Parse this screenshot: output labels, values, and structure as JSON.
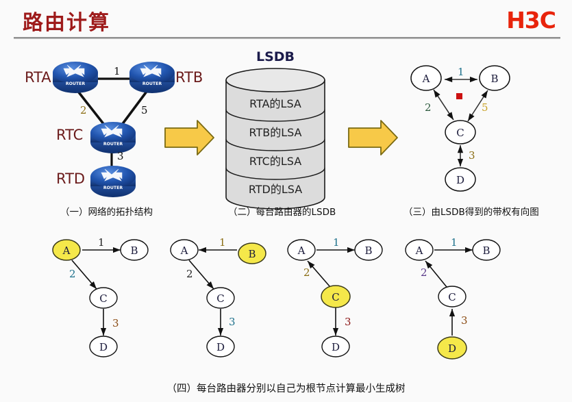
{
  "header": {
    "title": "路由计算",
    "logo": "H3C",
    "title_color": "#9e1b1b",
    "logo_color": "#e8240c"
  },
  "panel1": {
    "caption": "（一）网络的拓扑结构",
    "routers": [
      {
        "name": "RTA",
        "label": "ROUTER"
      },
      {
        "name": "RTB",
        "label": "ROUTER"
      },
      {
        "name": "RTC",
        "label": "ROUTER"
      },
      {
        "name": "RTD",
        "label": "ROUTER"
      }
    ],
    "links": [
      {
        "from": "RTA",
        "to": "RTB",
        "cost": "1"
      },
      {
        "from": "RTA",
        "to": "RTC",
        "cost": "2"
      },
      {
        "from": "RTB",
        "to": "RTC",
        "cost": "5"
      },
      {
        "from": "RTC",
        "to": "RTD",
        "cost": "3"
      }
    ]
  },
  "panel2": {
    "title": "LSDB",
    "caption": "（二）每台路由器的LSDB",
    "rows": [
      "RTA的LSA",
      "RTB的LSA",
      "RTC的LSA",
      "RTD的LSA"
    ]
  },
  "panel3": {
    "caption": "（三）由LSDB得到的带权有向图",
    "nodes": [
      "A",
      "B",
      "C",
      "D"
    ],
    "edges": [
      {
        "from": "A",
        "to": "B",
        "cost": "1",
        "bidirectional": true
      },
      {
        "from": "A",
        "to": "C",
        "cost": "2",
        "bidirectional": true
      },
      {
        "from": "B",
        "to": "C",
        "cost": "5",
        "bidirectional": true
      },
      {
        "from": "C",
        "to": "D",
        "cost": "3",
        "bidirectional": true
      }
    ],
    "marker": "red-square-marker"
  },
  "panel4": {
    "caption": "（四）每台路由器分别以自己为根节点计算最小生成树",
    "trees": [
      {
        "root": "A",
        "nodes": [
          "A",
          "B",
          "C",
          "D"
        ],
        "edges": [
          {
            "from": "A",
            "to": "B",
            "cost": "1"
          },
          {
            "from": "A",
            "to": "C",
            "cost": "2"
          },
          {
            "from": "C",
            "to": "D",
            "cost": "3"
          }
        ]
      },
      {
        "root": "B",
        "nodes": [
          "A",
          "B",
          "C",
          "D"
        ],
        "edges": [
          {
            "from": "B",
            "to": "A",
            "cost": "1"
          },
          {
            "from": "A",
            "to": "C",
            "cost": "2"
          },
          {
            "from": "C",
            "to": "D",
            "cost": "3"
          }
        ]
      },
      {
        "root": "C",
        "nodes": [
          "A",
          "B",
          "C",
          "D"
        ],
        "edges": [
          {
            "from": "A",
            "to": "B",
            "cost": "1"
          },
          {
            "from": "C",
            "to": "A",
            "cost": "2"
          },
          {
            "from": "C",
            "to": "D",
            "cost": "3"
          }
        ]
      },
      {
        "root": "D",
        "nodes": [
          "A",
          "B",
          "C",
          "D"
        ],
        "edges": [
          {
            "from": "A",
            "to": "B",
            "cost": "1"
          },
          {
            "from": "C",
            "to": "A",
            "cost": "2"
          },
          {
            "from": "D",
            "to": "C",
            "cost": "3"
          }
        ]
      }
    ]
  },
  "arrows": {
    "icon": "right-arrow-icon",
    "fill": "#f7c948",
    "stroke": "#7a6a12",
    "count": 2
  },
  "colors": {
    "router_blue": "#1b4fa8",
    "highlight_yellow": "#f5e84a",
    "cylinder_fill": "#dcdcdc",
    "marker_red": "#cc1111"
  }
}
